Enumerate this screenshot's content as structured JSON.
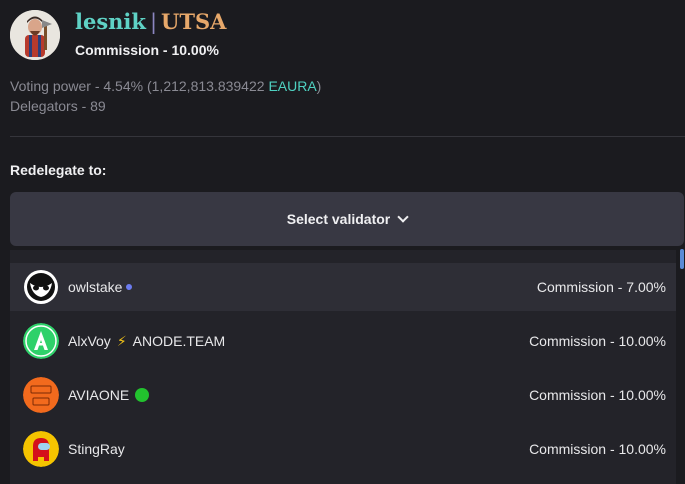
{
  "validator": {
    "name_part1": "lesnik",
    "separator": "|",
    "name_part2": "UTSA",
    "commission": "Commission - 10.00%",
    "voting_power_label": "Voting power - 4.54%",
    "voting_power_amount": "(1,212,813.839422 ",
    "voting_power_token": "EAURA",
    "voting_power_close": ")",
    "delegators": "Delegators - 89"
  },
  "redelegate": {
    "label": "Redelegate to:",
    "select_label": "Select validator"
  },
  "validator_list": [
    {
      "name": "owlstake",
      "badge": "blue-dot",
      "commission": "Commission - 7.00%"
    },
    {
      "name": "AlxVoy",
      "badge": "lightning-icon",
      "name_suffix": "ANODE.TEAM",
      "commission": "Commission - 10.00%"
    },
    {
      "name": "AVIAONE",
      "badge": "green-dot",
      "commission": "Commission - 10.00%"
    },
    {
      "name": "StingRay",
      "badge": "",
      "commission": "Commission - 10.00%"
    }
  ],
  "icons": {
    "bolt": "⚡"
  },
  "colors": {
    "background": "#1b1b1f",
    "accent_teal": "#4fd1c1",
    "name_orange": "#e7a86a",
    "select_bg": "#383843"
  }
}
